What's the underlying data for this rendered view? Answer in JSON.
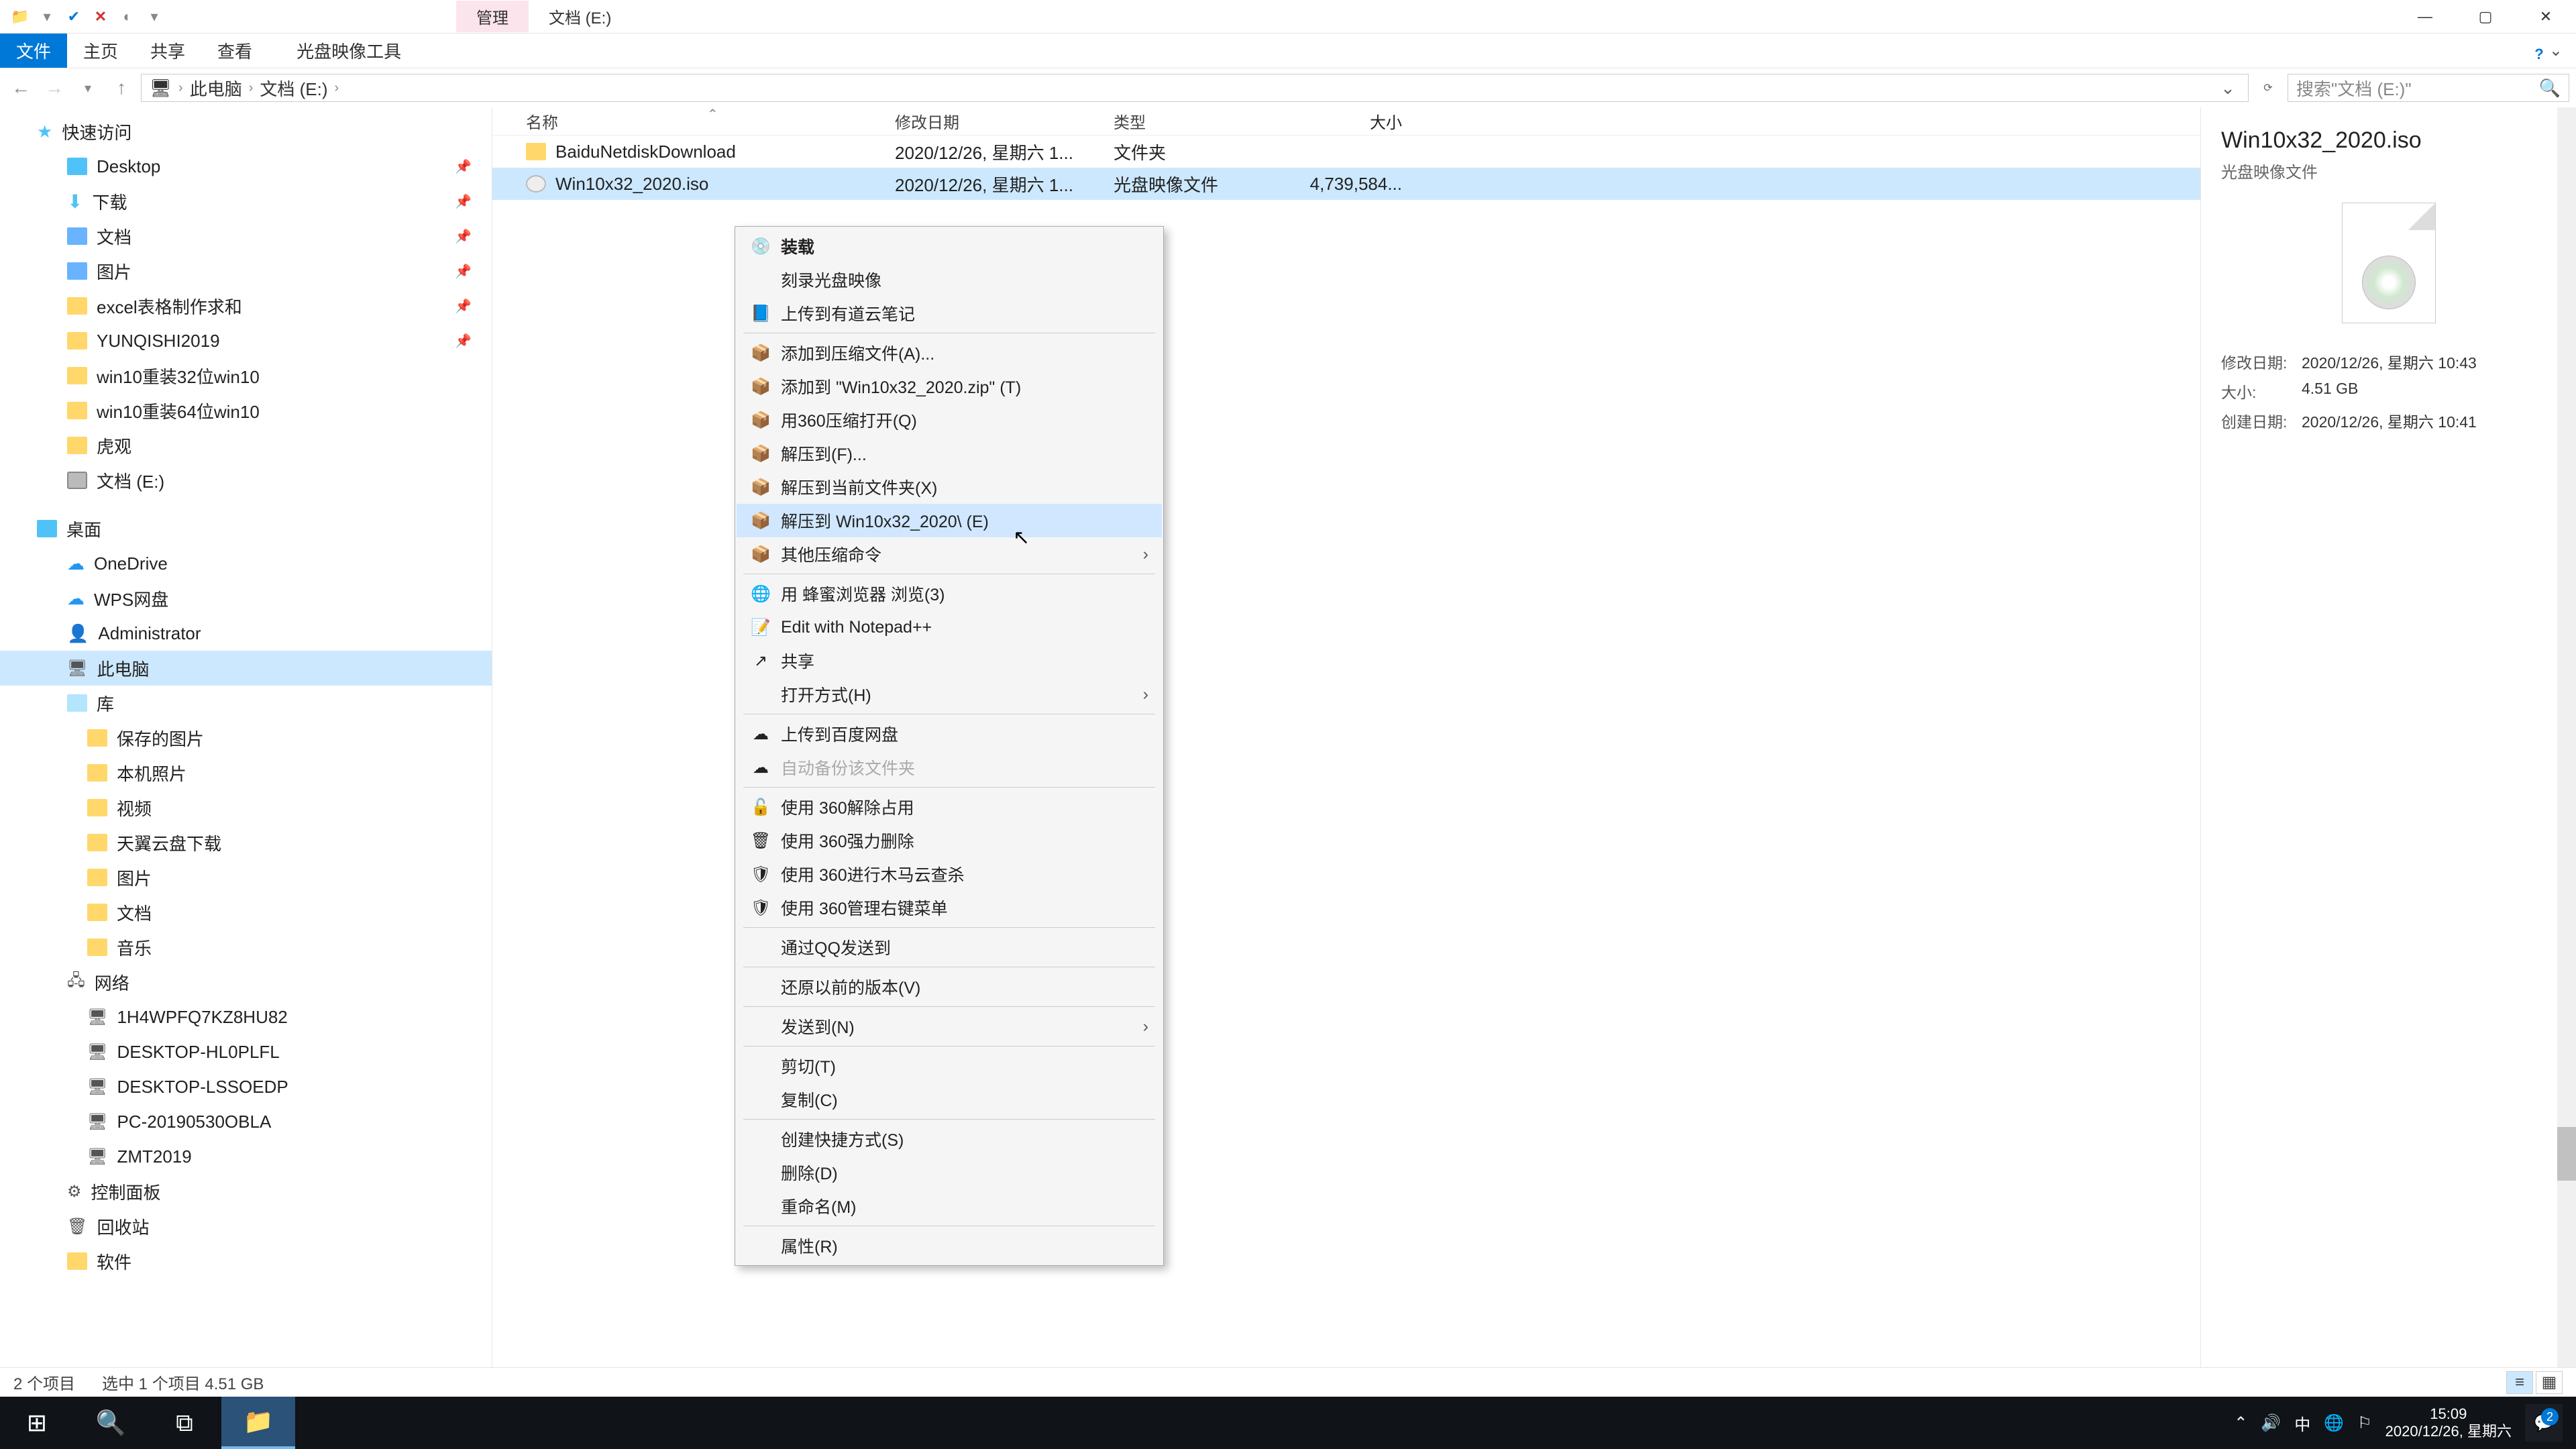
{
  "title_tabs": {
    "manage": "管理",
    "drive": "文档 (E:)"
  },
  "ribbon": {
    "file": "文件",
    "home": "主页",
    "share": "共享",
    "view": "查看",
    "contextual": "光盘映像工具"
  },
  "breadcrumb": {
    "pc": "此电脑",
    "drive": "文档 (E:)"
  },
  "search": {
    "placeholder": "搜索\"文档 (E:)\""
  },
  "columns": {
    "name": "名称",
    "date": "修改日期",
    "type": "类型",
    "size": "大小"
  },
  "sidebar": {
    "quick_access": "快速访问",
    "desktop": "Desktop",
    "downloads": "下载",
    "documents": "文档",
    "pictures": "图片",
    "excel": "excel表格制作求和",
    "yunqishi": "YUNQISHI2019",
    "win10_32": "win10重装32位win10",
    "win10_64": "win10重装64位win10",
    "huguan": "虎观",
    "drive_e": "文档 (E:)",
    "desktop2": "桌面",
    "onedrive": "OneDrive",
    "wps": "WPS网盘",
    "admin": "Administrator",
    "this_pc": "此电脑",
    "libraries": "库",
    "saved_pics": "保存的图片",
    "local_pics": "本机照片",
    "videos": "视频",
    "tianyi": "天翼云盘下载",
    "pictures2": "图片",
    "documents2": "文档",
    "music": "音乐",
    "network": "网络",
    "pc1": "1H4WPFQ7KZ8HU82",
    "pc2": "DESKTOP-HL0PLFL",
    "pc3": "DESKTOP-LSSOEDP",
    "pc4": "PC-20190530OBLA",
    "pc5": "ZMT2019",
    "control_panel": "控制面板",
    "recycle": "回收站",
    "software": "软件"
  },
  "files": [
    {
      "name": "BaiduNetdiskDownload",
      "date": "2020/12/26, 星期六 1...",
      "type": "文件夹",
      "size": "",
      "icon": "folder"
    },
    {
      "name": "Win10x32_2020.iso",
      "date": "2020/12/26, 星期六 1...",
      "type": "光盘映像文件",
      "size": "4,739,584...",
      "icon": "iso",
      "selected": true
    }
  ],
  "details": {
    "title": "Win10x32_2020.iso",
    "subtitle": "光盘映像文件",
    "rows": [
      {
        "label": "修改日期:",
        "value": "2020/12/26, 星期六 10:43"
      },
      {
        "label": "大小:",
        "value": "4.51 GB"
      },
      {
        "label": "创建日期:",
        "value": "2020/12/26, 星期六 10:41"
      }
    ]
  },
  "status": {
    "items": "2 个项目",
    "selection": "选中 1 个项目  4.51 GB"
  },
  "context_menu": [
    {
      "label": "装载",
      "bold": true,
      "icon": "disc"
    },
    {
      "label": "刻录光盘映像"
    },
    {
      "label": "上传到有道云笔记",
      "icon": "blue-square"
    },
    {
      "sep": true
    },
    {
      "label": "添加到压缩文件(A)...",
      "icon": "archive"
    },
    {
      "label": "添加到 \"Win10x32_2020.zip\" (T)",
      "icon": "archive"
    },
    {
      "label": "用360压缩打开(Q)",
      "icon": "archive"
    },
    {
      "label": "解压到(F)...",
      "icon": "archive"
    },
    {
      "label": "解压到当前文件夹(X)",
      "icon": "archive"
    },
    {
      "label": "解压到 Win10x32_2020\\ (E)",
      "icon": "archive",
      "hover": true
    },
    {
      "label": "其他压缩命令",
      "icon": "archive",
      "submenu": true
    },
    {
      "sep": true
    },
    {
      "label": "用 蜂蜜浏览器 浏览(3)",
      "icon": "globe"
    },
    {
      "label": "Edit with Notepad++",
      "icon": "npp"
    },
    {
      "label": "共享",
      "icon": "share"
    },
    {
      "label": "打开方式(H)",
      "submenu": true
    },
    {
      "sep": true
    },
    {
      "label": "上传到百度网盘",
      "icon": "cloud-up"
    },
    {
      "label": "自动备份该文件夹",
      "disabled": true,
      "icon": "cloud-up-grey"
    },
    {
      "sep": true
    },
    {
      "label": "使用 360解除占用",
      "icon": "unlock"
    },
    {
      "label": "使用 360强力删除",
      "icon": "trash360"
    },
    {
      "label": "使用 360进行木马云查杀",
      "icon": "shield-green"
    },
    {
      "label": "使用 360管理右键菜单",
      "icon": "shield-green"
    },
    {
      "sep": true
    },
    {
      "label": "通过QQ发送到"
    },
    {
      "sep": true
    },
    {
      "label": "还原以前的版本(V)"
    },
    {
      "sep": true
    },
    {
      "label": "发送到(N)",
      "submenu": true
    },
    {
      "sep": true
    },
    {
      "label": "剪切(T)"
    },
    {
      "label": "复制(C)"
    },
    {
      "sep": true
    },
    {
      "label": "创建快捷方式(S)"
    },
    {
      "label": "删除(D)"
    },
    {
      "label": "重命名(M)"
    },
    {
      "sep": true
    },
    {
      "label": "属性(R)"
    }
  ],
  "taskbar": {
    "time": "15:09",
    "date": "2020/12/26, 星期六",
    "ime": "中",
    "notif_count": "2"
  }
}
